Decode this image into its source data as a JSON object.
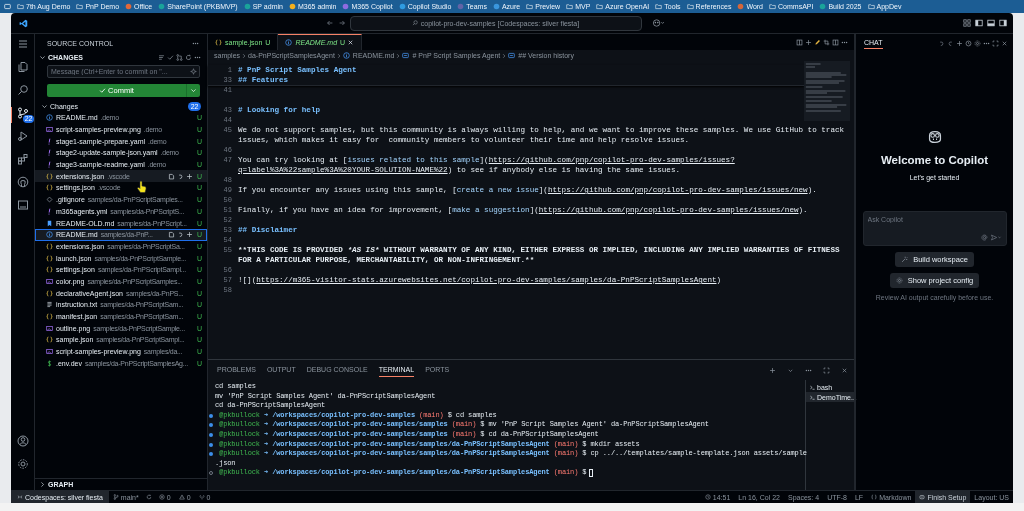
{
  "bookmarks": [
    {
      "label": "7th Aug Demo",
      "kind": "folder"
    },
    {
      "label": "PnP Demo",
      "kind": "folder"
    },
    {
      "label": "Office",
      "kind": "app",
      "color": "#e0683a"
    },
    {
      "label": "SharePoint (PKBMVP)",
      "kind": "app",
      "color": "#1aa39a"
    },
    {
      "label": "SP admin",
      "kind": "app",
      "color": "#1aa39a"
    },
    {
      "label": "M365 admin",
      "kind": "app",
      "color": "#f2b01e"
    },
    {
      "label": "M365 Copilot",
      "kind": "app",
      "color": "#8e6be0"
    },
    {
      "label": "Copilot Studio",
      "kind": "app",
      "color": "#2f9be0"
    },
    {
      "label": "Teams",
      "kind": "app",
      "color": "#6264a7"
    },
    {
      "label": "Azure",
      "kind": "app",
      "color": "#3a96dd"
    },
    {
      "label": "Preview",
      "kind": "folder"
    },
    {
      "label": "MVP",
      "kind": "folder"
    },
    {
      "label": "Azure OpenAI",
      "kind": "folder"
    },
    {
      "label": "Tools",
      "kind": "folder"
    },
    {
      "label": "References",
      "kind": "folder"
    },
    {
      "label": "Word",
      "kind": "app",
      "color": "#d4663a"
    },
    {
      "label": "CommsAPI",
      "kind": "folder"
    },
    {
      "label": "Build 2025",
      "kind": "app",
      "color": "#1aa39a"
    },
    {
      "label": "AppDev",
      "kind": "folder"
    }
  ],
  "title_bar": {
    "search": "copilot-pro-dev-samples [Codespaces: silver fiesta]"
  },
  "activity_bar": [
    {
      "kind": "explorer",
      "selected": false
    },
    {
      "kind": "search",
      "selected": false
    },
    {
      "kind": "source-control",
      "selected": true,
      "badge": "22"
    },
    {
      "kind": "run",
      "selected": false
    },
    {
      "kind": "extensions",
      "selected": false
    },
    {
      "kind": "github",
      "selected": false
    },
    {
      "kind": "remote",
      "selected": false
    }
  ],
  "sidebar": {
    "title": "SOURCE CONTROL",
    "section": "CHANGES",
    "message_placeholder": "Message (Ctrl+Enter to commit on \"...",
    "commit_label": "Commit",
    "group_label": "Changes",
    "group_count": "22",
    "files": [
      {
        "kind": "info",
        "name": "README.md",
        "path": ".demo",
        "status": "U",
        "selected": false,
        "hovered": false
      },
      {
        "kind": "image",
        "name": "script-samples-preview.png",
        "path": ".demo",
        "status": "U",
        "selected": false,
        "hovered": false
      },
      {
        "kind": "yaml",
        "name": "stage1-sample-prepare.yaml",
        "path": ".demo",
        "status": "U",
        "selected": false,
        "hovered": false
      },
      {
        "kind": "yaml",
        "name": "stage2-update-sample-json.yaml",
        "path": ".demo",
        "status": "U",
        "selected": false,
        "hovered": false
      },
      {
        "kind": "yaml",
        "name": "stage3-sample-readme.yaml",
        "path": ".demo",
        "status": "U",
        "selected": false,
        "hovered": false
      },
      {
        "kind": "json",
        "name": "extensions.json",
        "path": ".vscode",
        "status": "U",
        "selected": false,
        "hovered": true
      },
      {
        "kind": "json",
        "name": "settings.json",
        "path": ".vscode",
        "status": "U",
        "selected": false,
        "hovered": false
      },
      {
        "kind": "gitignore",
        "name": ".gitignore",
        "path": "samples/da-PnPScriptSamples...",
        "status": "U",
        "selected": false,
        "hovered": false
      },
      {
        "kind": "yaml",
        "name": "m365agents.yml",
        "path": "samples/da-PnPScriptS...",
        "status": "U",
        "selected": false,
        "hovered": false
      },
      {
        "kind": "bookmark",
        "name": "README-OLD.md",
        "path": "samples/da-PnPScript...",
        "status": "U",
        "selected": false,
        "hovered": false
      },
      {
        "kind": "info",
        "name": "README.md",
        "path": "samples/da-PnP...",
        "status": "U",
        "selected": true,
        "hovered": false
      },
      {
        "kind": "json",
        "name": "extensions.json",
        "path": "samples/da-PnPScriptSa...",
        "status": "U",
        "selected": false,
        "hovered": false
      },
      {
        "kind": "json",
        "name": "launch.json",
        "path": "samples/da-PnPScriptSample...",
        "status": "U",
        "selected": false,
        "hovered": false
      },
      {
        "kind": "json",
        "name": "settings.json",
        "path": "samples/da-PnPScriptSampl...",
        "status": "U",
        "selected": false,
        "hovered": false
      },
      {
        "kind": "image",
        "name": "color.png",
        "path": "samples/da-PnPScriptSamples...",
        "status": "U",
        "selected": false,
        "hovered": false
      },
      {
        "kind": "json",
        "name": "declarativeAgent.json",
        "path": "samples/da-PnPS...",
        "status": "U",
        "selected": false,
        "hovered": false
      },
      {
        "kind": "text",
        "name": "instruction.txt",
        "path": "samples/da-PnPScriptSam...",
        "status": "U",
        "selected": false,
        "hovered": false
      },
      {
        "kind": "json",
        "name": "manifest.json",
        "path": "samples/da-PnPScriptSam...",
        "status": "U",
        "selected": false,
        "hovered": false
      },
      {
        "kind": "image",
        "name": "outline.png",
        "path": "samples/da-PnPScriptSample...",
        "status": "U",
        "selected": false,
        "hovered": false
      },
      {
        "kind": "json",
        "name": "sample.json",
        "path": "samples/da-PnPScriptSampl...",
        "status": "U",
        "selected": false,
        "hovered": false
      },
      {
        "kind": "image",
        "name": "script-samples-preview.png",
        "path": "samples/da...",
        "status": "U",
        "selected": false,
        "hovered": false
      },
      {
        "kind": "env",
        "name": ".env.dev",
        "path": "samples/da-PnPScriptSamplesAg...",
        "status": "U",
        "selected": false,
        "hovered": false
      }
    ],
    "graph_label": "GRAPH"
  },
  "editor": {
    "tabs": [
      {
        "kind": "json",
        "label": "sample.json",
        "status": "U",
        "selected": false
      },
      {
        "kind": "info",
        "label": "README.md",
        "status": "U",
        "selected": true
      }
    ],
    "breadcrumb": [
      {
        "kind": "folder",
        "text": "samples"
      },
      {
        "kind": "folder",
        "text": "da-PnPScriptSamplesAgent"
      },
      {
        "kind": "info",
        "text": "README.md"
      },
      {
        "kind": "symbol",
        "text": "# PnP Script Samples Agent"
      },
      {
        "kind": "symbol",
        "text": "## Version history"
      }
    ],
    "sticky": [
      {
        "number": "1",
        "rows": [
          [
            {
              "kind": "heading",
              "text": "# PnP Script Samples Agent"
            }
          ]
        ]
      },
      {
        "number": "33",
        "rows": [
          [
            {
              "kind": "heading",
              "text": "## Features"
            }
          ]
        ]
      }
    ],
    "lines": [
      {
        "number": "41",
        "rows": [
          []
        ]
      },
      {
        "rows": [
          []
        ]
      },
      {
        "number": "43",
        "rows": [
          [
            {
              "kind": "heading",
              "text": "# Looking for help"
            }
          ]
        ]
      },
      {
        "number": "44",
        "rows": [
          []
        ]
      },
      {
        "number": "45",
        "rows": [
          [
            {
              "kind": "text",
              "text": "We do not support samples, but this community is always willing to help, and we want to improve these samples. We use GitHub to track"
            }
          ],
          [
            {
              "kind": "text",
              "text": "issues, which makes it easy for  community members to volunteer their time and help resolve issues."
            }
          ]
        ]
      },
      {
        "number": "46",
        "rows": [
          []
        ]
      },
      {
        "number": "47",
        "rows": [
          [
            {
              "kind": "text",
              "text": "You can try looking at ["
            },
            {
              "kind": "link",
              "text": "issues related to this sample"
            },
            {
              "kind": "text",
              "text": "]("
            },
            {
              "kind": "url",
              "text": "https://github.com/pnp/copilot-pro-dev-samples/issues?"
            }
          ],
          [
            {
              "kind": "url",
              "text": "q=label%3A%22sample%3A%20YOUR-SOLUTION-NAME%22"
            },
            {
              "kind": "text",
              "text": ") to see if anybody else is having the same issues."
            }
          ]
        ]
      },
      {
        "number": "48",
        "rows": [
          []
        ]
      },
      {
        "number": "49",
        "rows": [
          [
            {
              "kind": "text",
              "text": "If you encounter any issues using this sample, ["
            },
            {
              "kind": "link",
              "text": "create a new issue"
            },
            {
              "kind": "text",
              "text": "]("
            },
            {
              "kind": "url",
              "text": "https://github.com/pnp/copilot-pro-dev-samples/issues/new"
            },
            {
              "kind": "text",
              "text": ")."
            }
          ]
        ]
      },
      {
        "number": "50",
        "rows": [
          []
        ]
      },
      {
        "number": "51",
        "rows": [
          [
            {
              "kind": "text",
              "text": "Finally, if you have an idea for improvement, ["
            },
            {
              "kind": "link",
              "text": "make a suggestion"
            },
            {
              "kind": "text",
              "text": "]("
            },
            {
              "kind": "url",
              "text": "https://github.com/pnp/copilot-pro-dev-samples/issues/new"
            },
            {
              "kind": "text",
              "text": ")."
            }
          ]
        ]
      },
      {
        "number": "52",
        "rows": [
          []
        ]
      },
      {
        "number": "53",
        "rows": [
          [
            {
              "kind": "heading",
              "text": "## Disclaimer"
            }
          ]
        ]
      },
      {
        "number": "54",
        "rows": [
          []
        ]
      },
      {
        "number": "55",
        "rows": [
          [
            {
              "kind": "bold",
              "text": "**THIS CODE IS PROVIDED "
            },
            {
              "kind": "italic",
              "text": "*AS IS*"
            },
            {
              "kind": "bold",
              "text": " WITHOUT WARRANTY OF ANY KIND, EITHER EXPRESS OR IMPLIED, INCLUDING ANY IMPLIED WARRANTIES OF FITNESS"
            }
          ],
          [
            {
              "kind": "bold",
              "text": "FOR A PARTICULAR PURPOSE, MERCHANTABILITY, OR NON-INFRINGEMENT.**"
            }
          ]
        ]
      },
      {
        "number": "56",
        "rows": [
          []
        ]
      },
      {
        "number": "57",
        "rows": [
          [
            {
              "kind": "text",
              "text": "![]("
            },
            {
              "kind": "url",
              "text": "https://m365-visitor-stats.azurewebsites.net/copilot-pro-dev-samples/samples/da-PnPScriptSamplesAgent"
            },
            {
              "kind": "text",
              "text": ")"
            }
          ]
        ]
      },
      {
        "number": "58",
        "rows": [
          []
        ]
      }
    ]
  },
  "panel": {
    "tabs": [
      {
        "label": "PROBLEMS",
        "selected": false
      },
      {
        "label": "OUTPUT",
        "selected": false
      },
      {
        "label": "DEBUG CONSOLE",
        "selected": false
      },
      {
        "label": "TERMINAL",
        "selected": true
      },
      {
        "label": "PORTS",
        "selected": false
      }
    ],
    "terminal": [
      {
        "kind": "plain",
        "text": "cd samples"
      },
      {
        "kind": "plain",
        "text": "mv 'PnP Script Samples Agent' da-PnPScriptSamplesAgent"
      },
      {
        "kind": "plain",
        "text": "cd da-PnPScriptSamplesAgent"
      },
      {
        "kind": "prompt",
        "finished": true,
        "user": "@pkbullock",
        "arrow": "➜",
        "path": "/workspaces/copilot-pro-dev-samples",
        "branch": "(main)",
        "symbol": "$",
        "command": "cd samples"
      },
      {
        "kind": "prompt",
        "finished": true,
        "user": "@pkbullock",
        "arrow": "➜",
        "path": "/workspaces/copilot-pro-dev-samples/samples",
        "branch": "(main)",
        "symbol": "$",
        "command": "mv 'PnP Script Samples Agent' da-PnPScriptSamplesAgent"
      },
      {
        "kind": "prompt",
        "finished": true,
        "user": "@pkbullock",
        "arrow": "➜",
        "path": "/workspaces/copilot-pro-dev-samples/samples",
        "branch": "(main)",
        "symbol": "$",
        "command": "cd da-PnPScriptSamplesAgent"
      },
      {
        "kind": "prompt",
        "finished": true,
        "user": "@pkbullock",
        "arrow": "➜",
        "path": "/workspaces/copilot-pro-dev-samples/samples/da-PnPScriptSamplesAgent",
        "branch": "(main)",
        "symbol": "$",
        "command": "mkdir assets"
      },
      {
        "kind": "prompt",
        "finished": true,
        "user": "@pkbullock",
        "arrow": "➜",
        "path": "/workspaces/copilot-pro-dev-samples/samples/da-PnPScriptSamplesAgent",
        "branch": "(main)",
        "symbol": "$",
        "command": "cp ../../templates/sample-template.json assets/sample"
      },
      {
        "kind": "plain",
        "text": ".json"
      },
      {
        "kind": "prompt",
        "finished": false,
        "user": "@pkbullock",
        "arrow": "➜",
        "path": "/workspaces/copilot-pro-dev-samples/samples/da-PnPScriptSamplesAgent",
        "branch": "(main)",
        "symbol": "$"
      }
    ],
    "terminals": [
      {
        "label": "bash",
        "selected": false
      },
      {
        "label": "DemoTime...",
        "selected": true
      }
    ]
  },
  "chat": {
    "title": "CHAT",
    "welcome": "Welcome to Copilot",
    "subtitle": "Let's get started",
    "input_placeholder": "Ask Copilot",
    "buttons": [
      {
        "kind": "workspace",
        "label": "Build workspace"
      },
      {
        "kind": "gear",
        "label": "Show project config"
      }
    ],
    "note": "Review AI output carefully before use."
  },
  "status_bar": {
    "left": [
      {
        "kind": "remote",
        "text": "Codespaces: silver fiesta"
      },
      {
        "kind": "branch",
        "text": "main*"
      },
      {
        "kind": "sync"
      },
      {
        "kind": "errors",
        "text": "0"
      },
      {
        "kind": "warnings",
        "text": "0"
      },
      {
        "kind": "ports",
        "text": "0"
      }
    ],
    "right": [
      {
        "kind": "clock",
        "text": "14:51"
      },
      {
        "kind": "plain",
        "text": "Ln 16, Col 22"
      },
      {
        "kind": "plain",
        "text": "Spaces: 4"
      },
      {
        "kind": "plain",
        "text": "UTF-8"
      },
      {
        "kind": "plain",
        "text": "LF"
      },
      {
        "kind": "language",
        "text": "Markdown"
      },
      {
        "kind": "setup",
        "text": "Finish Setup"
      },
      {
        "kind": "plain",
        "text": "Layout: US"
      }
    ]
  }
}
